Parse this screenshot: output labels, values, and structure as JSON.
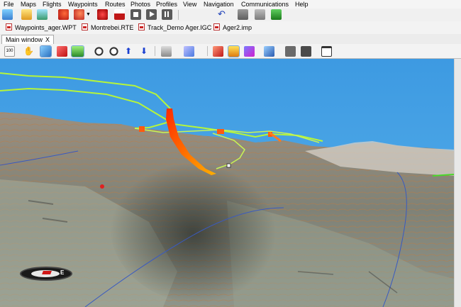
{
  "menu": [
    "File",
    "Maps",
    "Flights",
    "Waypoints",
    "Routes",
    "Photos",
    "Profiles",
    "View",
    "Navigation",
    "Communications",
    "Help"
  ],
  "toolbar1_icons": [
    "new-waypoint-icon",
    "open-map-icon",
    "layers-icon",
    "flight-open-icon",
    "flight-options-icon",
    "dropdown-icon",
    "route-icon",
    "flag-icon",
    "stop-icon",
    "play-icon",
    "pause-icon",
    "undo-icon",
    "export-icon",
    "import-icon",
    "excel-icon"
  ],
  "files": [
    {
      "name": "Waypoints_ager.WPT"
    },
    {
      "name": "Montrebei.RTE"
    },
    {
      "name": "Track_Demo Ager.IGC"
    },
    {
      "name": "Ager2.imp"
    }
  ],
  "tab": {
    "label": "Main window",
    "close": "X"
  },
  "toolbar2_icons": [
    "zoom-100-icon",
    "hand-icon",
    "3d-cube-icon",
    "arrow-tool-icon",
    "map-tool-icon",
    "zoom-out-icon",
    "zoom-in-icon",
    "arrow-up-icon",
    "arrow-down-icon",
    "pan-icon",
    "terrain-icon",
    "track-icon",
    "altitude-icon",
    "chart-icon",
    "satellite-icon",
    "camera-icon",
    "video-icon",
    "window-icon"
  ],
  "colors": {
    "sky": "#4aa5e6",
    "track": "#aef03a",
    "flight": "#ff5a10",
    "terrain": "#8b8f82"
  },
  "compass": {
    "east_label": "E"
  }
}
